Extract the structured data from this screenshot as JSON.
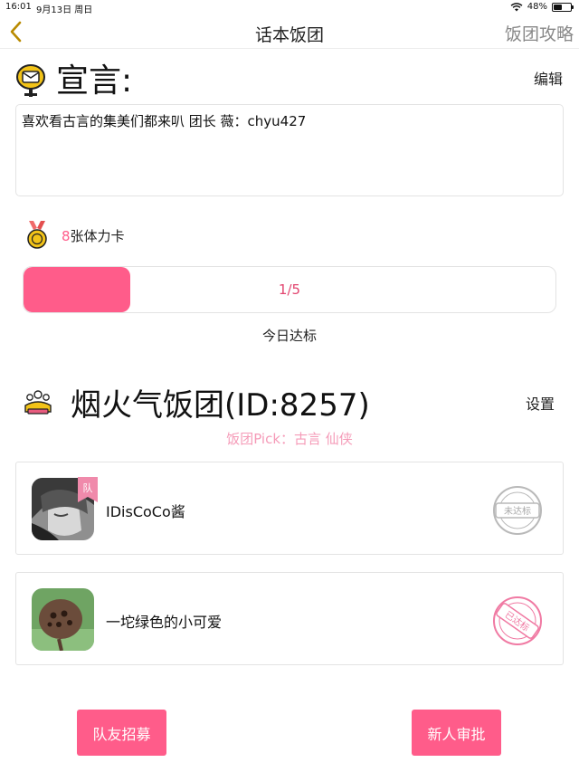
{
  "status_bar": {
    "time": "16:01",
    "date": "9月13日 周日",
    "battery_text": "48%",
    "battery_level": 0.48
  },
  "nav": {
    "back_icon": "chevron-left",
    "title": "话本饭团",
    "guide_link": "饭团攻略"
  },
  "declaration": {
    "icon": "mailbox",
    "title": "宣言:",
    "edit_label": "编辑",
    "text": "喜欢看古言的集美们都来叭 团长 薇：chyu427"
  },
  "stamina": {
    "icon": "medal",
    "count": "8",
    "label": "张体力卡"
  },
  "progress": {
    "current": 1,
    "total": 5,
    "text": "1/5",
    "fraction": 0.2,
    "caption": "今日达标"
  },
  "group": {
    "icon": "team",
    "name": "烟火气饭团(ID:8257)",
    "settings_label": "设置",
    "pick": "饭团Pick：古言  仙侠"
  },
  "members": [
    {
      "name": "IDisCoCo酱",
      "role_badge": "队",
      "status": "未达标",
      "status_color": "#b9b9b9"
    },
    {
      "name": "一坨绿色的小可爱",
      "role_badge": "",
      "status": "已达标",
      "status_color": "#f07aa3"
    }
  ],
  "buttons": {
    "recruit": "队友招募",
    "approve": "新人审批"
  },
  "colors": {
    "accent": "#ff5c8a",
    "pick_text": "#f59bb8",
    "gold": "#e7b51c"
  }
}
